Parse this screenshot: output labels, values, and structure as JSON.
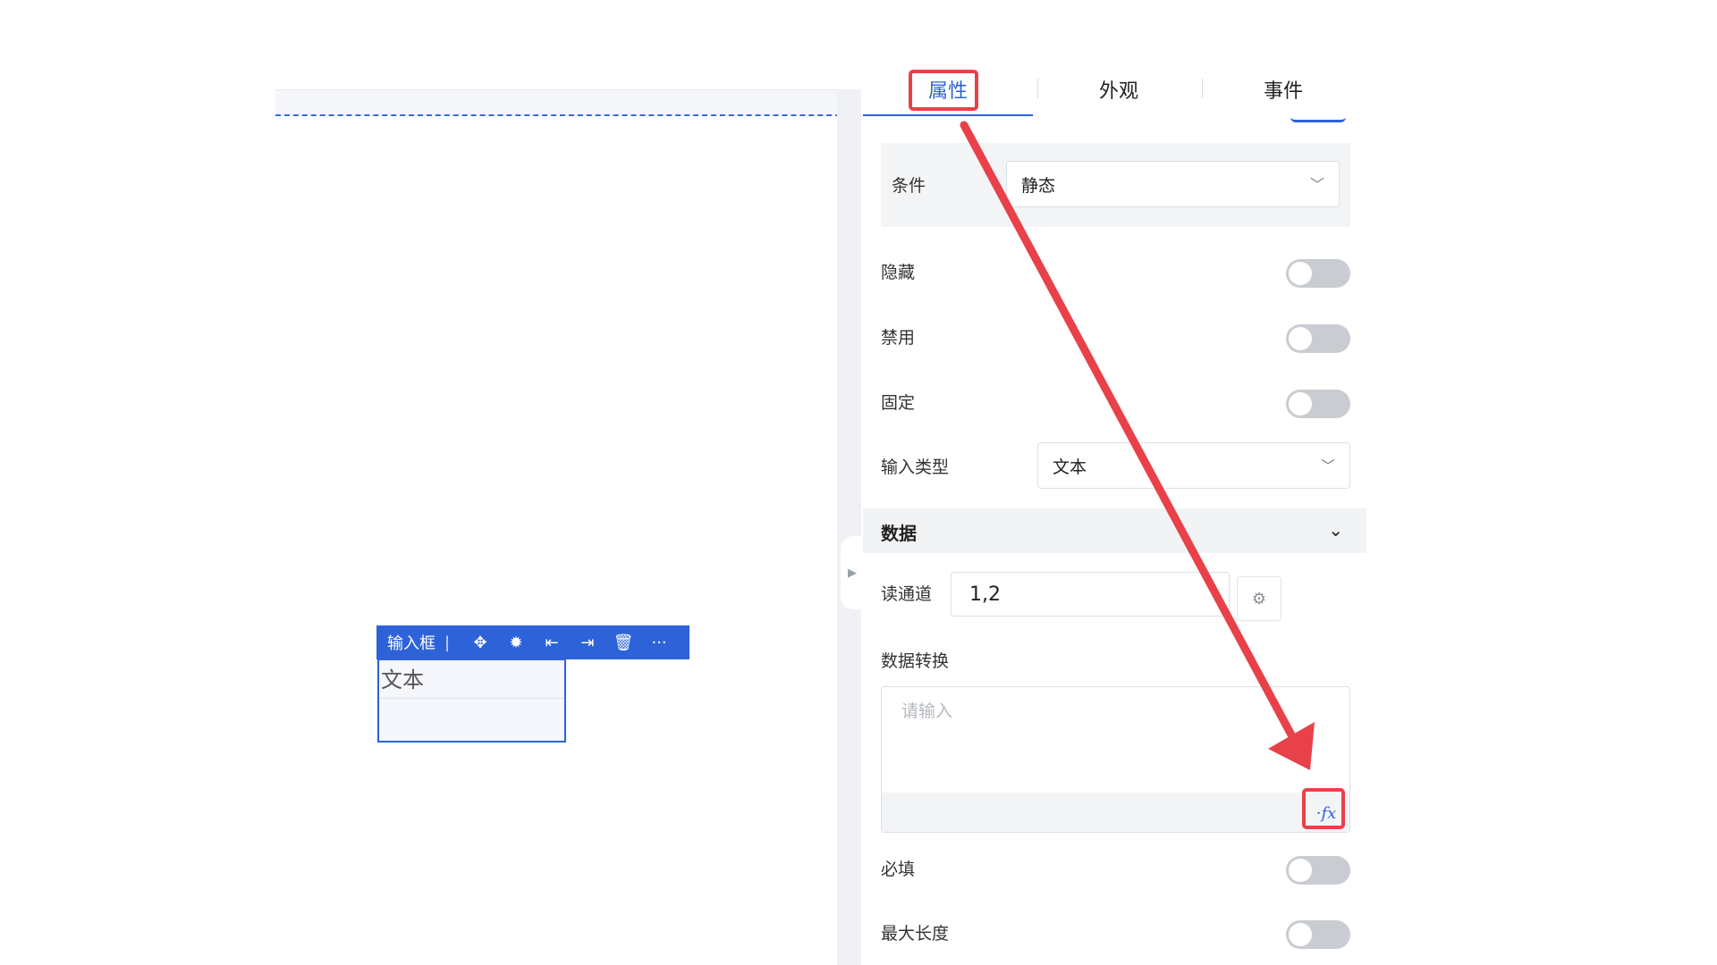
{
  "tabs": [
    {
      "label": "属性",
      "active": true
    },
    {
      "label": "外观",
      "active": false
    },
    {
      "label": "事件",
      "active": false
    }
  ],
  "canvas": {
    "widget_toolbar": {
      "title": "输入框",
      "separator": "|",
      "icons": [
        "move-icon",
        "bug-icon",
        "move-left-icon",
        "move-right-icon",
        "trash-icon",
        "more-icon"
      ],
      "glyphs": [
        "✥",
        "✹",
        "⇤",
        "⇥",
        "🗑",
        "···"
      ]
    },
    "widget": {
      "label": "文本"
    }
  },
  "properties": {
    "condition": {
      "label": "条件",
      "value": "静态"
    },
    "hidden": {
      "label": "隐藏",
      "on": false
    },
    "disabled": {
      "label": "禁用",
      "on": false
    },
    "fixed": {
      "label": "固定",
      "on": false
    },
    "input_type": {
      "label": "输入类型",
      "value": "文本"
    }
  },
  "data_section": {
    "title": "数据",
    "read_channel": {
      "label": "读通道",
      "value": "1,2"
    },
    "data_transform": {
      "label": "数据转换",
      "placeholder": "请输入",
      "fx_label": "·fx"
    }
  },
  "more_properties": {
    "required": {
      "label": "必填",
      "on": false
    },
    "max_length": {
      "label": "最大长度",
      "on": false
    }
  },
  "colors": {
    "accent": "#2d62d9",
    "annotation": "#e8414a",
    "toggle_off": "#c9ccd1"
  }
}
